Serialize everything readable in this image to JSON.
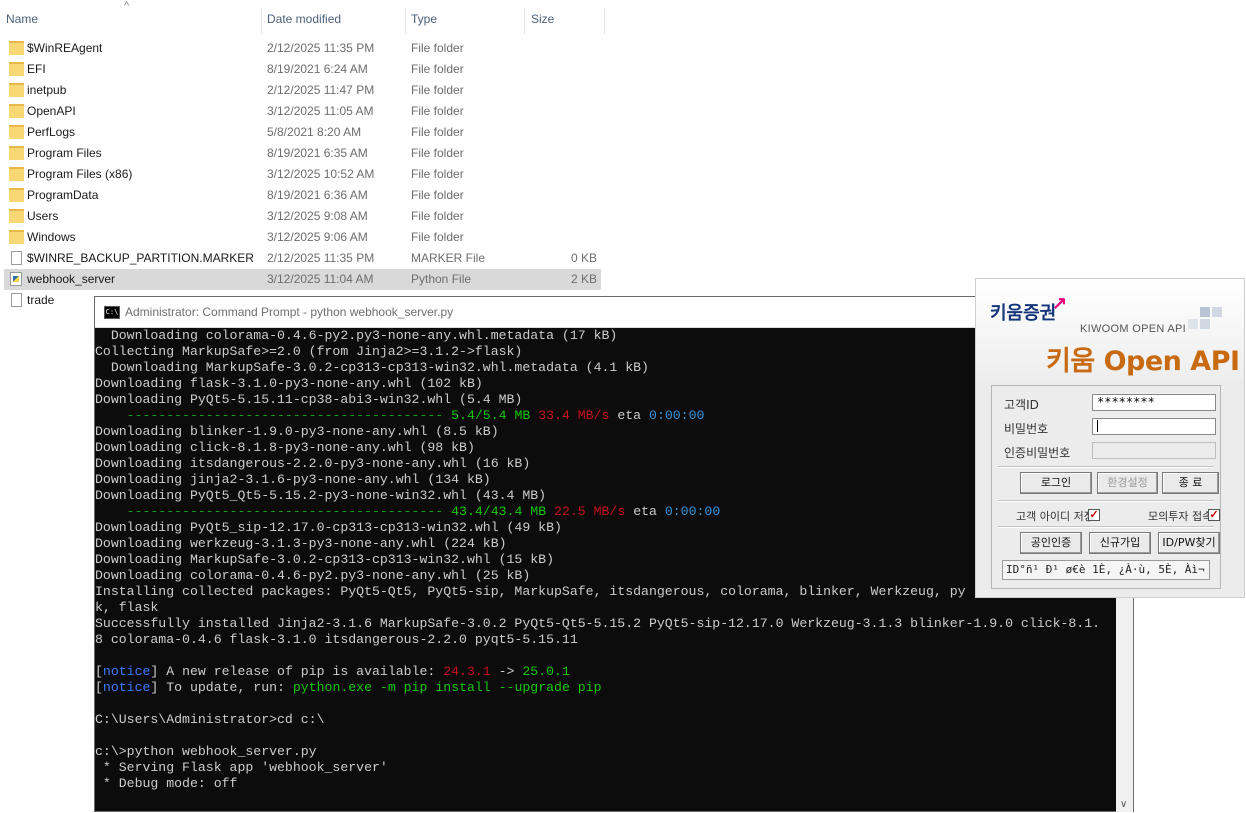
{
  "explorer": {
    "columns": {
      "name": "Name",
      "date": "Date modified",
      "type": "Type",
      "size": "Size"
    },
    "rows": [
      {
        "name": "$WinREAgent",
        "date": "2/12/2025 11:35 PM",
        "type": "File folder",
        "size": "",
        "icon": "folder-icon"
      },
      {
        "name": "EFI",
        "date": "8/19/2021 6:24 AM",
        "type": "File folder",
        "size": "",
        "icon": "folder-icon"
      },
      {
        "name": "inetpub",
        "date": "2/12/2025 11:47 PM",
        "type": "File folder",
        "size": "",
        "icon": "folder-icon"
      },
      {
        "name": "OpenAPI",
        "date": "3/12/2025 11:05 AM",
        "type": "File folder",
        "size": "",
        "icon": "folder-icon"
      },
      {
        "name": "PerfLogs",
        "date": "5/8/2021 8:20 AM",
        "type": "File folder",
        "size": "",
        "icon": "folder-icon"
      },
      {
        "name": "Program Files",
        "date": "8/19/2021 6:35 AM",
        "type": "File folder",
        "size": "",
        "icon": "folder-icon"
      },
      {
        "name": "Program Files (x86)",
        "date": "3/12/2025 10:52 AM",
        "type": "File folder",
        "size": "",
        "icon": "folder-icon"
      },
      {
        "name": "ProgramData",
        "date": "8/19/2021 6:36 AM",
        "type": "File folder",
        "size": "",
        "icon": "folder-icon"
      },
      {
        "name": "Users",
        "date": "3/12/2025 9:08 AM",
        "type": "File folder",
        "size": "",
        "icon": "folder-icon"
      },
      {
        "name": "Windows",
        "date": "3/12/2025 9:06 AM",
        "type": "File folder",
        "size": "",
        "icon": "folder-icon"
      },
      {
        "name": "$WINRE_BACKUP_PARTITION.MARKER",
        "date": "2/12/2025 11:35 PM",
        "type": "MARKER File",
        "size": "0 KB",
        "icon": "file-icon"
      },
      {
        "name": "webhook_server",
        "date": "3/12/2025 11:04 AM",
        "type": "Python File",
        "size": "2 KB",
        "icon": "python-file-icon"
      },
      {
        "name": "trade",
        "date": "",
        "type": "",
        "size": "",
        "icon": "file-icon"
      }
    ]
  },
  "cmd": {
    "title": "Administrator: Command Prompt - python  webhook_server.py",
    "icon_text": "C:\\",
    "lines": [
      "  Downloading colorama-0.4.6-py2.py3-none-any.whl.metadata (17 kB)",
      "Collecting MarkupSafe>=2.0 (from Jinja2>=3.1.2->flask)",
      "  Downloading MarkupSafe-3.0.2-cp313-cp313-win32.whl.metadata (4.1 kB)",
      "Downloading flask-3.1.0-py3-none-any.whl (102 kB)",
      "Downloading PyQt5-5.15.11-cp38-abi3-win32.whl (5.4 MB)",
      "",
      "Downloading blinker-1.9.0-py3-none-any.whl (8.5 kB)",
      "Downloading click-8.1.8-py3-none-any.whl (98 kB)",
      "Downloading itsdangerous-2.2.0-py3-none-any.whl (16 kB)",
      "Downloading jinja2-3.1.6-py3-none-any.whl (134 kB)",
      "Downloading PyQt5_Qt5-5.15.2-py3-none-win32.whl (43.4 MB)",
      "",
      "Downloading PyQt5_sip-12.17.0-cp313-cp313-win32.whl (49 kB)",
      "Downloading werkzeug-3.1.3-py3-none-any.whl (224 kB)",
      "Downloading MarkupSafe-3.0.2-cp313-cp313-win32.whl (15 kB)",
      "Downloading colorama-0.4.6-py2.py3-none-any.whl (25 kB)",
      "Installing collected packages: PyQt5-Qt5, PyQt5-sip, MarkupSafe, itsdangerous, colorama, blinker, Werkzeug, py",
      "k, flask",
      "Successfully installed Jinja2-3.1.6 MarkupSafe-3.0.2 PyQt5-Qt5-5.15.2 PyQt5-sip-12.17.0 Werkzeug-3.1.3 blinker-1.9.0 click-8.1.",
      "8 colorama-0.4.6 flask-3.1.0 itsdangerous-2.2.0 pyqt5-5.15.11",
      "",
      "",
      "",
      "",
      "C:\\Users\\Administrator>cd c:\\",
      "",
      "c:\\>python webhook_server.py",
      " * Serving Flask app 'webhook_server'",
      " * Debug mode: off"
    ],
    "progress1": {
      "bar": "    ----------------------------------------",
      "amount": "5.4/5.4 MB",
      "speed": "33.4 MB/s",
      "eta_label": "eta",
      "eta": "0:00:00"
    },
    "progress2": {
      "bar": "    ----------------------------------------",
      "amount": "43.4/43.4 MB",
      "speed": "22.5 MB/s",
      "eta_label": "eta",
      "eta": "0:00:00"
    },
    "notice1": {
      "tag": "notice",
      "text": " A new release of pip is available: ",
      "old": "24.3.1",
      "arrow": " -> ",
      "new": "25.0.1"
    },
    "notice2": {
      "tag": "notice",
      "text": " To update, run: ",
      "cmd": "python.exe -m pip install --upgrade pip"
    }
  },
  "kiwoom": {
    "brand": "키움증권",
    "sub": "KIWOOM OPEN API",
    "title": "키움 Open API",
    "id_label": "고객ID",
    "id_value": "********",
    "pw_label": "비밀번호",
    "pw_value": "",
    "cert_label": "인증비밀번호",
    "login_btn": "로그인",
    "settings_btn": "환경설정",
    "exit_btn": "종 료",
    "save_id_label": "고객 아이디 저장",
    "mock_label": "모의투자 접속",
    "save_id_checked": true,
    "mock_checked": true,
    "cert_btn": "공인인증",
    "signup_btn": "신규가입",
    "find_btn": "ID/PW찾기",
    "status": "ID°ñ¹ Ð¹ ø€è 1È, ¿À·ù, 5È, Àì¬"
  }
}
